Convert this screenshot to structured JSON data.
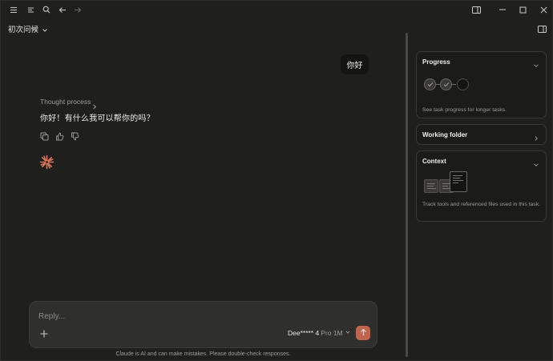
{
  "window": {
    "conversation_title": "初次问候",
    "icons": {
      "menu": "hamburger-menu-icon",
      "sidebar_list": "list-icon",
      "search": "search-icon",
      "back": "arrow-left-icon",
      "forward": "arrow-right-icon",
      "panel": "panel-toggle-icon",
      "minimize": "minimize-icon",
      "maximize": "maximize-icon",
      "close": "close-icon"
    }
  },
  "chat": {
    "user_message": "你好",
    "thought_label": "Thought process",
    "assistant_message": "你好！有什么我可以帮你的吗？",
    "actions": [
      "copy-icon",
      "thumbs-up-icon",
      "thumbs-down-icon"
    ]
  },
  "composer": {
    "placeholder": "Reply...",
    "model_name": "Dee***** 4",
    "model_plan": "Pro 1M",
    "disclaimer": "Claude is AI and can make mistakes. Please double-check responses."
  },
  "side_panel": {
    "progress": {
      "title": "Progress",
      "description": "See task progress for longer tasks.",
      "steps": [
        "done",
        "done",
        "pending"
      ]
    },
    "working_folder": {
      "title": "Working folder"
    },
    "context": {
      "title": "Context",
      "description": "Track tools and referenced files used in this task."
    }
  },
  "colors": {
    "background": "#1f1f1e",
    "accent": "#c2634b",
    "spark": "#d97757",
    "card_bg": "#1b1b1a",
    "border": "#3a3936"
  }
}
